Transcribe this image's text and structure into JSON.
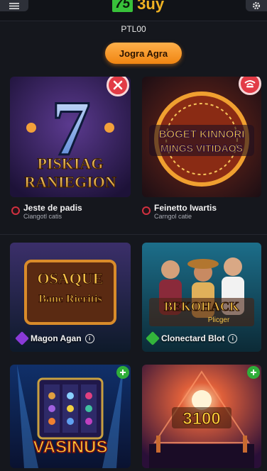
{
  "header": {
    "logo_badge": "75",
    "logo_text": "3uy"
  },
  "balance": "PTL00",
  "cta_label": "Jogra Agra",
  "games": [
    {
      "art_title_1": "PISKIAG",
      "art_title_2": "RANIEGION",
      "art_number": "7",
      "title": "Jeste de padis",
      "subtitle": "Ciangotl catis",
      "badge": "close"
    },
    {
      "art_title_1": "BOGET KINNORI",
      "art_title_2": "MINGS VITIDAOS",
      "title": "Feinetto Iwartis",
      "subtitle": "Carngol catie",
      "badge": "wifi"
    },
    {
      "art_title_1": "OSAQUE",
      "art_title_2": "Bane Rieritis",
      "title": "Magon Agan",
      "gem_color": "#8a3ad8"
    },
    {
      "art_title_1": "BEKOHACK",
      "art_title_2": "Plicger",
      "title": "Clonectard Blot",
      "gem_color": "#33b53b"
    },
    {
      "art_title_1": "VASINUS",
      "badge": "plus"
    },
    {
      "art_title_1": "3100",
      "badge": "plus"
    }
  ]
}
